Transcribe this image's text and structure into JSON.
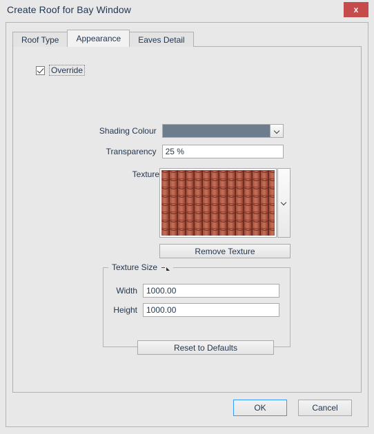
{
  "window": {
    "title": "Create Roof for Bay Window",
    "close_label": "x",
    "close_icon": "close-icon",
    "close_color": "#c64b4b"
  },
  "tabs": [
    {
      "label": "Roof Type",
      "active": false
    },
    {
      "label": "Appearance",
      "active": true
    },
    {
      "label": "Eaves Detail",
      "active": false
    }
  ],
  "appearance": {
    "override": {
      "label": "Override",
      "checked": true
    },
    "shading_colour": {
      "label": "Shading Colour",
      "value_color": "#6d7d8e",
      "arrow_icon": "chevron-down-icon"
    },
    "transparency": {
      "label": "Transparency",
      "value": "25 %"
    },
    "texture": {
      "label": "Texture",
      "preview_name": "roof-tile-texture",
      "expander_icon": "chevron-down-icon",
      "tile_colors": {
        "base": "#b35440",
        "highlight": "#c4705b",
        "shadow": "#5e2418",
        "deep": "#8c4031"
      }
    },
    "remove_texture_label": "Remove Texture",
    "texture_size": {
      "title": "Texture Size",
      "collapse_icon": "collapse-triangle-icon",
      "width": {
        "label": "Width",
        "value": "1000.00"
      },
      "height": {
        "label": "Height",
        "value": "1000.00"
      },
      "reset_label": "Reset to Defaults"
    }
  },
  "footer": {
    "ok_label": "OK",
    "cancel_label": "Cancel",
    "focus_color": "#3399ff"
  }
}
